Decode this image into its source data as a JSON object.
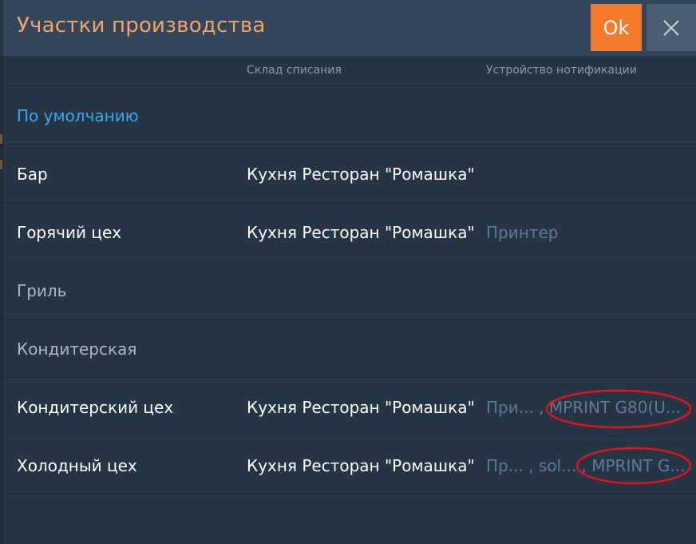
{
  "dialog": {
    "title": "Участки производства",
    "ok_label": "Ok",
    "close_icon": "close-icon"
  },
  "columns": {
    "warehouse": "Склад списания",
    "device": "Устройство нотификации"
  },
  "rows": [
    {
      "name": "По умолчанию",
      "warehouse": "",
      "device": ""
    },
    {
      "name": "Бар",
      "warehouse": "Кухня Ресторан \"Ромашка\"",
      "device": ""
    },
    {
      "name": "Горячий цех",
      "warehouse": "Кухня Ресторан \"Ромашка\"",
      "device": "Принтер"
    },
    {
      "name": "Гриль",
      "warehouse": "",
      "device": ""
    },
    {
      "name": "Кондитерская",
      "warehouse": "",
      "device": ""
    },
    {
      "name": "Кондитерский цех",
      "warehouse": "Кухня Ресторан \"Ромашка\"",
      "device": "При... , MPRINT G80(U..."
    },
    {
      "name": "Холодный цех",
      "warehouse": "Кухня Ресторан \"Ромашка\"",
      "device": "Пр... , sol... , MPRINT G..."
    }
  ],
  "colors": {
    "background": "#263545",
    "header": "#33465a",
    "accent_title": "#f0a46a",
    "ok_button": "#f47a2c",
    "link": "#35a8ec",
    "annotation": "#e0131b"
  }
}
